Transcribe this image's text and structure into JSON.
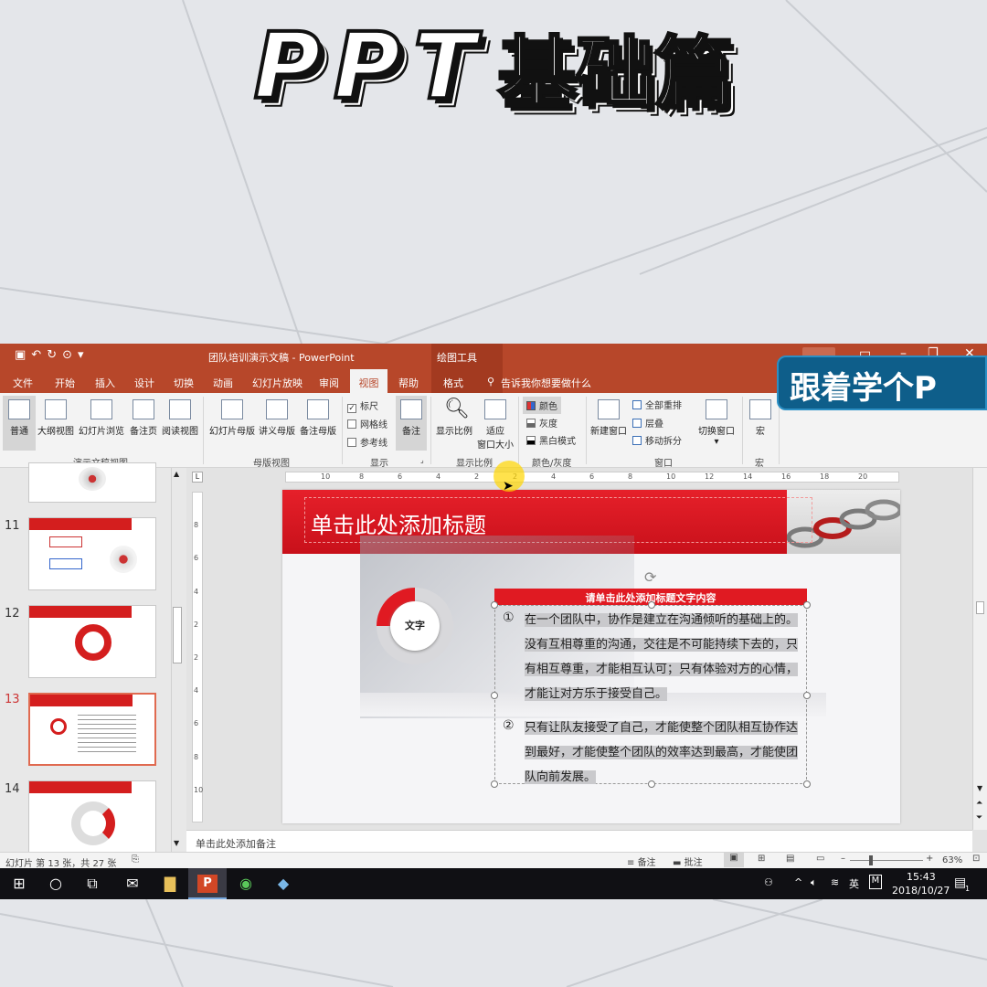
{
  "video_title": {
    "ppt": "PPT",
    "suffix": "基础篇"
  },
  "follow_badge": "跟着学个P",
  "window": {
    "doc_title": "团队培训演示文稿 - PowerPoint",
    "context_tab_group": "绘图工具"
  },
  "tabs": [
    {
      "label": "文件"
    },
    {
      "label": "开始"
    },
    {
      "label": "插入"
    },
    {
      "label": "设计"
    },
    {
      "label": "切换"
    },
    {
      "label": "动画"
    },
    {
      "label": "幻灯片放映"
    },
    {
      "label": "审阅"
    },
    {
      "label": "视图"
    },
    {
      "label": "帮助"
    },
    {
      "label": "格式"
    }
  ],
  "active_tab": "视图",
  "tell_me": "告诉我你想要做什么",
  "ribbon": {
    "presentation_views": {
      "label": "演示文稿视图",
      "buttons": [
        "普通",
        "大纲视图",
        "幻灯片浏览",
        "备注页",
        "阅读视图"
      ]
    },
    "master_views": {
      "label": "母版视图",
      "buttons": [
        "幻灯片母版",
        "讲义母版",
        "备注母版"
      ]
    },
    "show": {
      "label": "显示",
      "checkboxes": [
        {
          "label": "标尺",
          "checked": true
        },
        {
          "label": "网格线",
          "checked": false
        },
        {
          "label": "参考线",
          "checked": false
        }
      ],
      "notes_button": "备注"
    },
    "zoom": {
      "label": "显示比例",
      "zoom_button": "显示比例",
      "fit_button_1": "适应",
      "fit_button_2": "窗口大小"
    },
    "color": {
      "label": "颜色/灰度",
      "items": [
        "颜色",
        "灰度",
        "黑白模式"
      ]
    },
    "window": {
      "label": "窗口",
      "new_window": "新建窗口",
      "items": [
        "全部重排",
        "层叠",
        "移动拆分"
      ],
      "switch": "切换窗口"
    },
    "macro": {
      "label": "宏",
      "button": "宏"
    }
  },
  "ruler_labels": [
    "10",
    "8",
    "6",
    "4",
    "2",
    "2",
    "4",
    "6",
    "8",
    "10",
    "12",
    "14",
    "16",
    "18",
    "20"
  ],
  "ruler_v_labels": [
    "8",
    "6",
    "4",
    "2",
    "2",
    "4",
    "6",
    "8",
    "10"
  ],
  "thumbnails": [
    {
      "num": "11"
    },
    {
      "num": "12"
    },
    {
      "num": "13"
    },
    {
      "num": "14"
    }
  ],
  "slide": {
    "title": "单击此处添加标题",
    "ring_label": "文字",
    "content_header": "请单击此处添加标题文字内容",
    "items": [
      {
        "num": "①",
        "text": "在一个团队中，协作是建立在沟通倾听的基础上的。没有互相尊重的沟通，交往是不可能持续下去的，只有相互尊重，才能相互认可；只有体验对方的心情，才能让对方乐于接受自己。"
      },
      {
        "num": "②",
        "text": "只有让队友接受了自己，才能使整个团队相互协作达到最好，才能使整个团队的效率达到最高，才能使团队向前发展。"
      }
    ]
  },
  "notes_placeholder": "单击此处添加备注",
  "status": {
    "slide_info": "幻灯片 第 13 张，共 27 张",
    "notes": "备注",
    "comments": "批注",
    "zoom": "63%"
  },
  "taskbar": {
    "ime": "英",
    "time": "15:43",
    "date": "2018/10/27",
    "notif_count": "1"
  }
}
